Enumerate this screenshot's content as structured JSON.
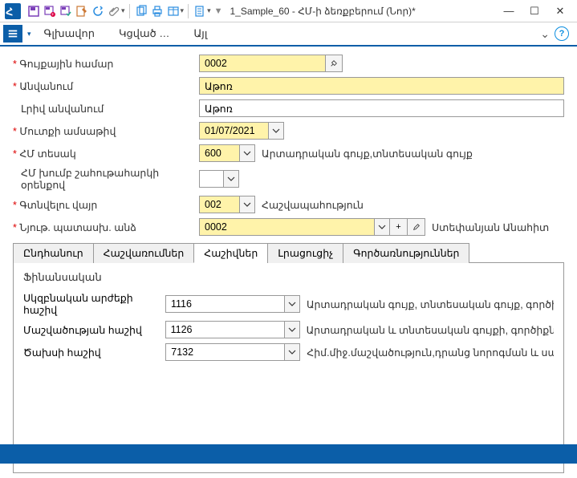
{
  "titlebar": {
    "title": "1_Sample_60 - ՀՄ-ի ձեռքբերում (Նոր)*",
    "min": "—",
    "max": "☐",
    "close": "✕"
  },
  "menu": {
    "items": [
      "Գլխավոր",
      "Կցված …",
      "Այլ"
    ],
    "expand": "⌄"
  },
  "form": {
    "inv_number_label": "Գույքային համար",
    "inv_number_value": "0002",
    "name_label": "Անվանում",
    "name_value": "Աթոռ",
    "fullname_label": "Լրիվ անվանում",
    "fullname_value": "Աթոռ",
    "date_label": "Մուտքի ամսաթիվ",
    "date_value": "01/07/2021",
    "type_label": "ՀՄ տեսակ",
    "type_value": "600",
    "type_text": "Արտադրական գույք,տնտեսական գույք",
    "group_label": "ՀՄ խումբ շահութահարկի օրենքով",
    "group_value": "",
    "loc_label": "Գտնվելու վայր",
    "loc_value": "002",
    "loc_text": "Հաշվապահություն",
    "resp_label": "Նյութ. պատասխ. անձ",
    "resp_value": "0002",
    "resp_text": "Ստեփանյան Անահիտ"
  },
  "tabs": {
    "t1": "Ընդհանուր",
    "t2": "Հաշվառումներ",
    "t3": "Հաշիվներ",
    "t4": "Լրացուցիչ",
    "t5": "Գործառնություններ"
  },
  "panel": {
    "title": "Ֆինանսական",
    "r1_label": "Սկզբնական արժեքի հաշիվ",
    "r1_value": "1116",
    "r1_text": "Արտադրական գույք, տնտեսական գույք, գործիքներ",
    "r2_label": "Մաշվածության հաշիվ",
    "r2_value": "1126",
    "r2_text": "Արտադրական և տնտեսական գույքի, գործիքների մ",
    "r3_label": "Ծախսի հաշիվ",
    "r3_value": "7132",
    "r3_text": "Հիմ.միջ.մաշվածություն,դրանց նորոգման և սպաս.ծ"
  }
}
